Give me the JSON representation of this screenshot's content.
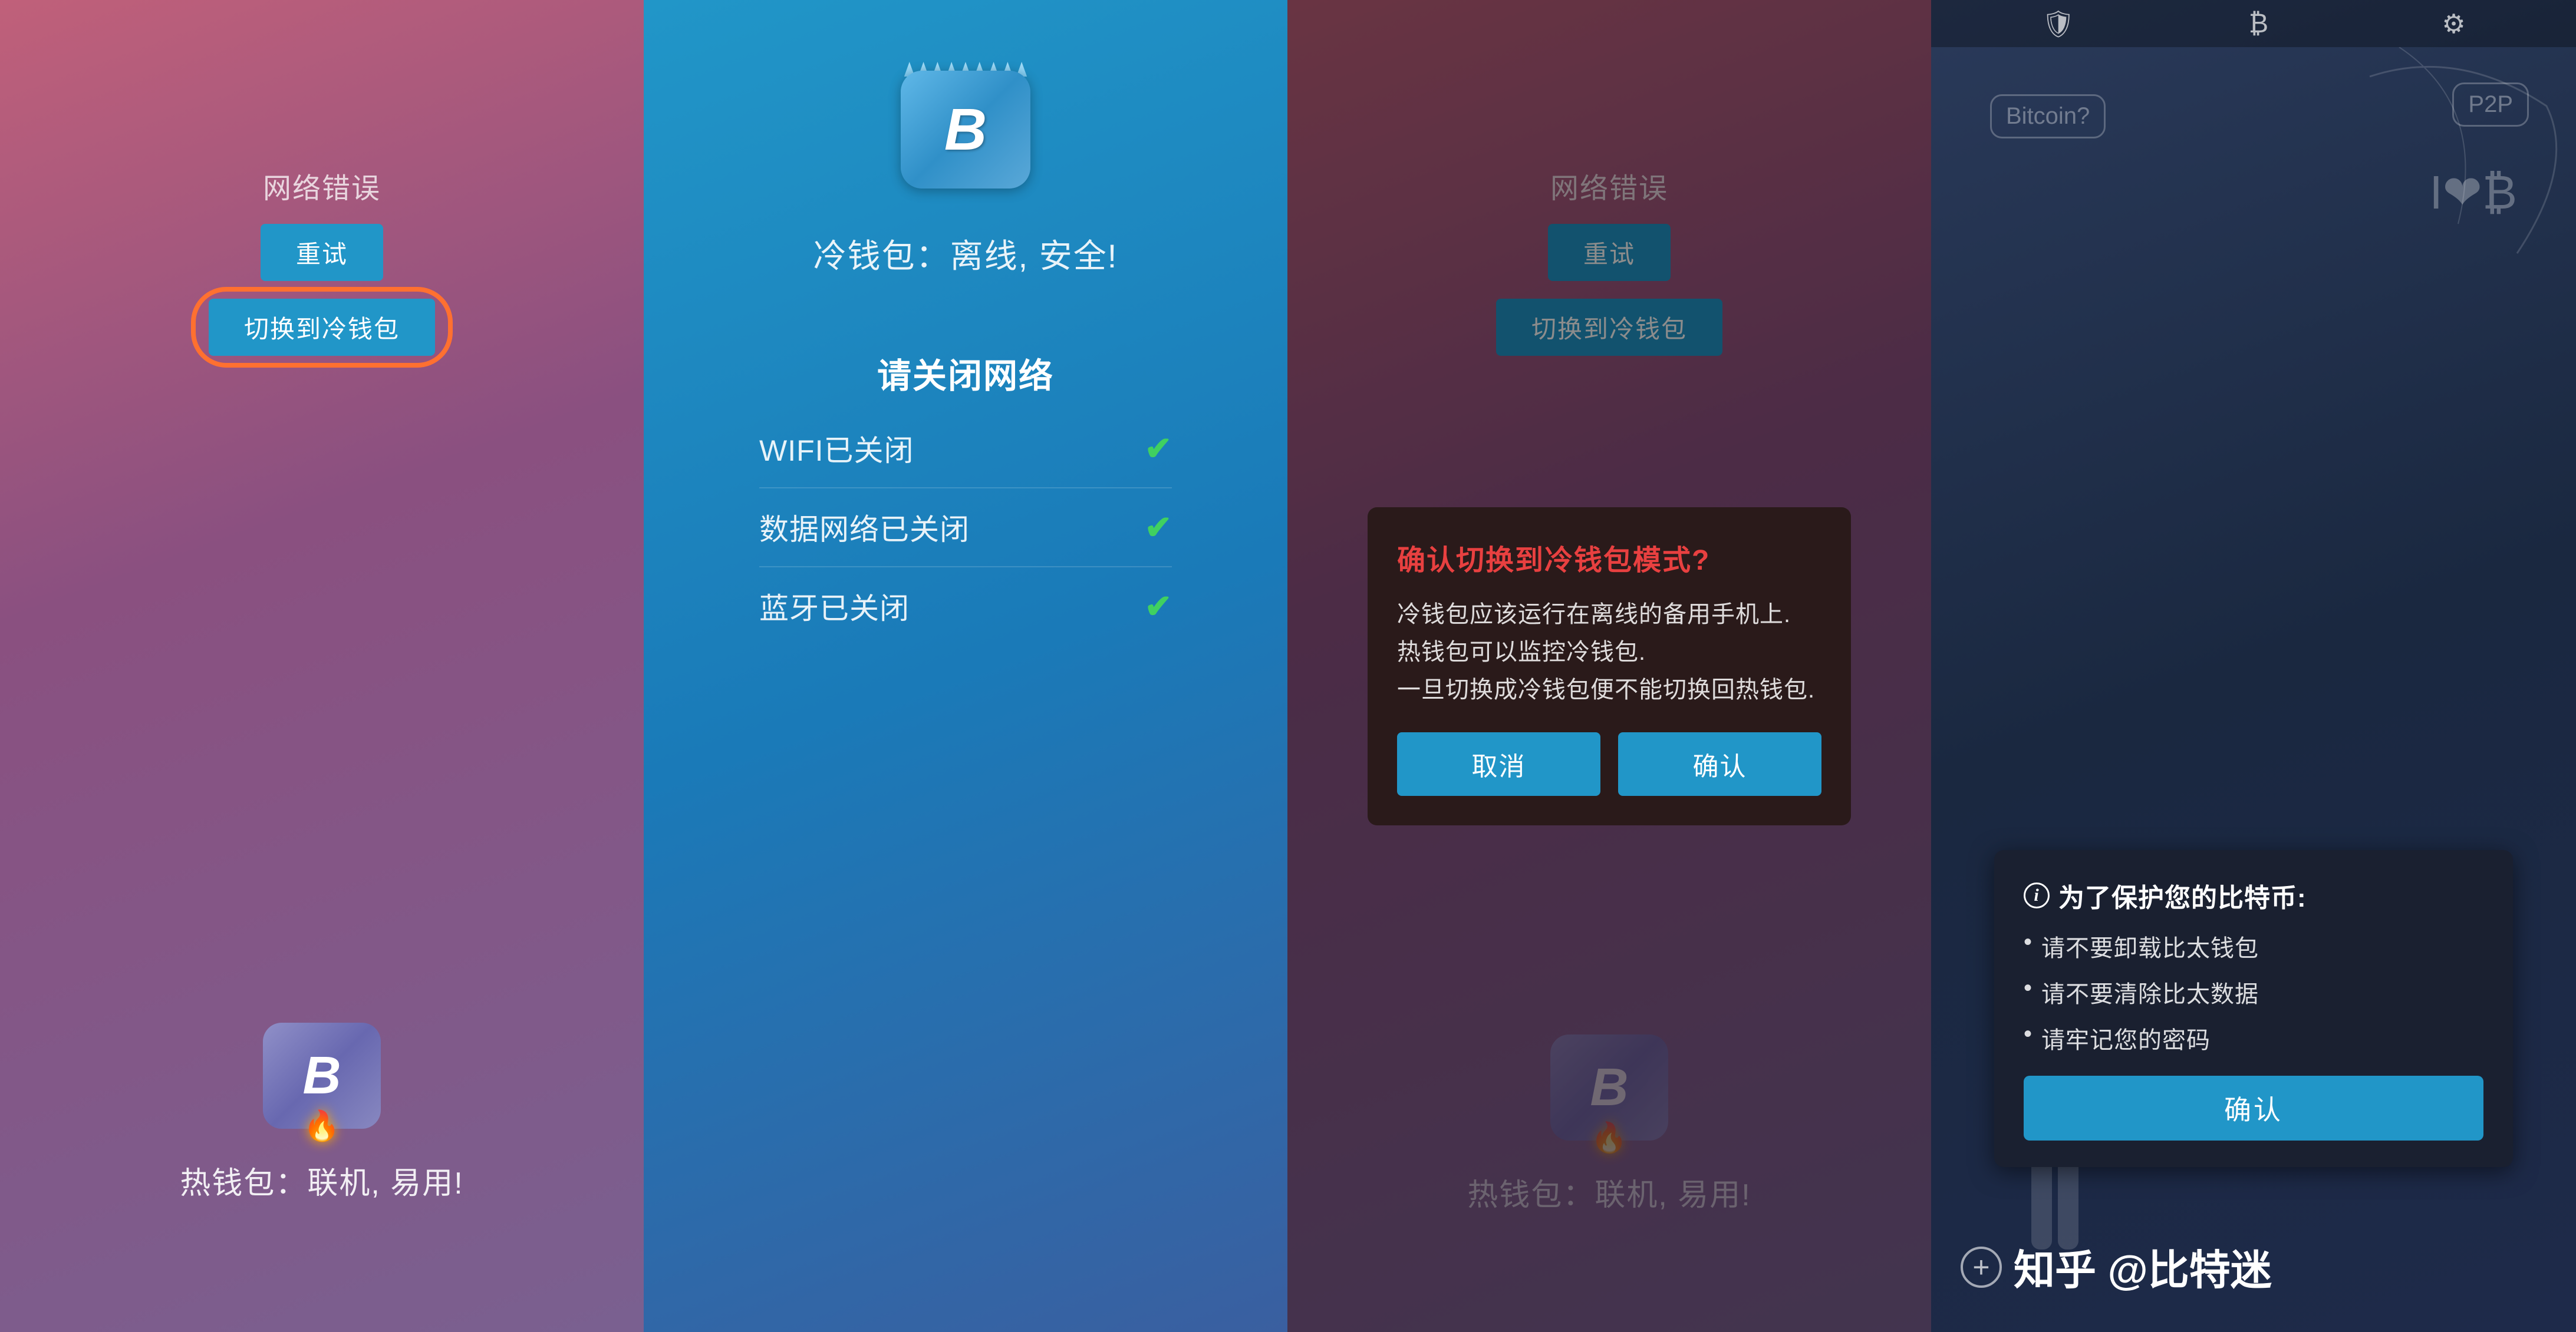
{
  "panel1": {
    "error_title": "网络错误",
    "retry_btn": "重试",
    "switch_btn": "切换到冷钱包",
    "wallet_label": "热钱包：联机, 易用!",
    "has_orange_circle": true
  },
  "panel2": {
    "cold_wallet_label": "冷钱包：离线, 安全!",
    "network_close_title": "请关闭网络",
    "network_items": [
      {
        "label": "WIFI已关闭",
        "checked": true
      },
      {
        "label": "数据网络已关闭",
        "checked": true
      },
      {
        "label": "蓝牙已关闭",
        "checked": true
      }
    ]
  },
  "panel3": {
    "error_title": "网络错误",
    "retry_btn": "重试",
    "switch_btn": "切换到冷钱包",
    "wallet_label": "热钱包：联机, 易用!",
    "dialog": {
      "title": "确认切换到冷钱包模式?",
      "body": "冷钱包应该运行在离线的备用手机上.\n热钱包可以监控冷钱包.\n一旦切换成冷钱包便不能切换回热钱包.",
      "cancel_btn": "取消",
      "confirm_btn": "确认"
    }
  },
  "panel4": {
    "topbar": {
      "shield_icon": "🛡",
      "bitcoin_icon": "₿",
      "gear_icon": "⚙"
    },
    "bubble_bitcoin": "Bitcoin?",
    "bubble_p2p": "P2P",
    "heart_bitcoin": "I❤₿",
    "protect_dialog": {
      "info_icon": "i",
      "title": "为了保护您的比特币:",
      "items": [
        "请不要卸载比太钱包",
        "请不要清除比太数据",
        "请牢记您的密码"
      ],
      "confirm_btn": "确认"
    },
    "brand_label": "知乎 @比特迷",
    "add_icon": "+"
  }
}
